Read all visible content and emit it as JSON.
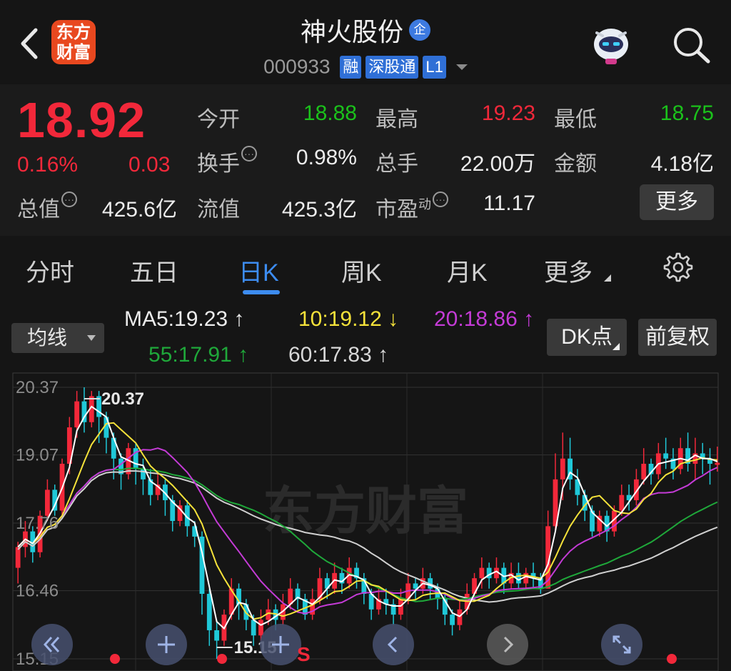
{
  "header": {
    "logo_line1": "东方",
    "logo_line2": "财富",
    "stock_name": "神火股份",
    "badge": "企",
    "code": "000933",
    "tags": [
      "融",
      "深股通",
      "L1"
    ]
  },
  "quote": {
    "price": "18.92",
    "change_pct": "0.16%",
    "change_val": "0.03",
    "fields": {
      "open_label": "今开",
      "open_value": "18.88",
      "high_label": "最高",
      "high_value": "19.23",
      "low_label": "最低",
      "low_value": "18.75",
      "turnover_label": "换手",
      "turnover_value": "0.98%",
      "volume_label": "总手",
      "volume_value": "22.00万",
      "amount_label": "金额",
      "amount_value": "4.18亿",
      "mktcap_label": "总值",
      "mktcap_value": "425.6亿",
      "float_label": "流值",
      "float_value": "425.3亿",
      "pe_label": "市盈",
      "pe_sup": "动",
      "pe_value": "11.17"
    },
    "more_label": "更多"
  },
  "tabs": [
    "分时",
    "五日",
    "日K",
    "周K",
    "月K",
    "更多"
  ],
  "active_tab": "日K",
  "ma": {
    "select_label": "均线",
    "ma5": "MA5:19.23 ↑",
    "ma10": "10:19.12 ↓",
    "ma20": "20:18.86 ↑",
    "ma55": "55:17.91 ↑",
    "ma60": "60:17.83 ↑",
    "dk_label": "DK点",
    "fq_label": "前复权"
  },
  "colors": {
    "up": "#f2283a",
    "down": "#1fc8d8",
    "ma5": "#ffffff",
    "ma10": "#f5e23a",
    "ma20": "#c43bd6",
    "ma55": "#1fa83a",
    "ma60": "#d0d0d0",
    "accent": "#3d8cf0"
  },
  "chart_data": {
    "type": "candlestick",
    "y_ticks": [
      "20.37",
      "19.07",
      "17.76",
      "16.46",
      "15.15"
    ],
    "ylim": [
      15.15,
      20.37
    ],
    "high_marker": "20.37",
    "low_marker": "15.15",
    "watermark": "东方财富",
    "signal_label": "S",
    "candles": [
      [
        16.9,
        17.3,
        16.6,
        17.4
      ],
      [
        17.3,
        17.6,
        17.1,
        17.8
      ],
      [
        17.6,
        17.2,
        17.0,
        17.7
      ],
      [
        17.2,
        17.9,
        17.1,
        18.0
      ],
      [
        17.9,
        18.4,
        17.8,
        18.6
      ],
      [
        18.4,
        18.0,
        17.9,
        18.5
      ],
      [
        18.0,
        18.9,
        17.9,
        19.0
      ],
      [
        18.9,
        19.6,
        18.7,
        19.8
      ],
      [
        19.6,
        20.1,
        19.4,
        20.3
      ],
      [
        20.1,
        19.7,
        19.5,
        20.37
      ],
      [
        19.7,
        20.2,
        19.6,
        20.3
      ],
      [
        20.2,
        19.8,
        19.3,
        20.3
      ],
      [
        19.8,
        19.4,
        19.1,
        19.9
      ],
      [
        19.4,
        19.0,
        18.6,
        19.5
      ],
      [
        19.0,
        18.7,
        18.4,
        19.1
      ],
      [
        18.7,
        19.2,
        18.6,
        19.3
      ],
      [
        19.2,
        18.8,
        18.5,
        19.3
      ],
      [
        18.8,
        18.6,
        18.3,
        19.0
      ],
      [
        18.6,
        18.3,
        18.1,
        18.8
      ],
      [
        18.3,
        18.5,
        18.2,
        18.7
      ],
      [
        18.5,
        18.2,
        17.9,
        18.6
      ],
      [
        18.2,
        17.8,
        17.6,
        18.3
      ],
      [
        17.8,
        18.1,
        17.7,
        18.2
      ],
      [
        18.1,
        17.7,
        17.5,
        18.2
      ],
      [
        17.7,
        17.5,
        17.3,
        17.8
      ],
      [
        17.5,
        16.4,
        16.0,
        17.6
      ],
      [
        16.4,
        15.7,
        15.4,
        16.5
      ],
      [
        15.7,
        15.5,
        15.15,
        15.9
      ],
      [
        15.5,
        16.0,
        15.4,
        16.1
      ],
      [
        16.0,
        16.5,
        15.9,
        16.7
      ],
      [
        16.5,
        16.2,
        15.9,
        16.6
      ],
      [
        16.2,
        15.9,
        15.7,
        16.3
      ],
      [
        15.9,
        15.6,
        15.4,
        16.0
      ],
      [
        15.6,
        15.9,
        15.5,
        16.1
      ],
      [
        15.9,
        16.1,
        15.8,
        16.3
      ],
      [
        16.1,
        15.9,
        15.7,
        16.2
      ],
      [
        15.9,
        16.2,
        15.8,
        16.4
      ],
      [
        16.2,
        16.5,
        16.1,
        16.7
      ],
      [
        16.5,
        16.3,
        16.1,
        16.6
      ],
      [
        16.3,
        16.0,
        15.9,
        16.4
      ],
      [
        16.0,
        16.3,
        15.9,
        16.5
      ],
      [
        16.3,
        16.7,
        16.2,
        16.9
      ],
      [
        16.7,
        16.5,
        16.3,
        16.8
      ],
      [
        16.5,
        16.8,
        16.4,
        17.0
      ],
      [
        16.8,
        16.6,
        16.4,
        16.9
      ],
      [
        16.6,
        16.9,
        16.5,
        17.1
      ],
      [
        16.9,
        16.7,
        16.5,
        17.0
      ],
      [
        16.7,
        16.4,
        16.2,
        16.8
      ],
      [
        16.4,
        16.1,
        15.9,
        16.5
      ],
      [
        16.1,
        16.3,
        16.0,
        16.5
      ],
      [
        16.3,
        16.2,
        16.0,
        16.5
      ],
      [
        16.2,
        16.0,
        15.8,
        16.3
      ],
      [
        16.0,
        16.3,
        15.9,
        16.5
      ],
      [
        16.3,
        16.6,
        16.2,
        16.8
      ],
      [
        16.6,
        16.5,
        16.3,
        16.7
      ],
      [
        16.5,
        16.7,
        16.4,
        16.9
      ],
      [
        16.7,
        16.5,
        16.3,
        16.8
      ],
      [
        16.5,
        16.3,
        16.1,
        16.6
      ],
      [
        16.3,
        16.0,
        15.8,
        16.4
      ],
      [
        16.0,
        15.8,
        15.6,
        16.1
      ],
      [
        15.8,
        16.1,
        15.7,
        16.3
      ],
      [
        16.1,
        16.4,
        16.0,
        16.6
      ],
      [
        16.4,
        16.7,
        16.3,
        16.8
      ],
      [
        16.7,
        16.9,
        16.5,
        17.1
      ],
      [
        16.9,
        16.7,
        16.5,
        17.0
      ],
      [
        16.7,
        16.9,
        16.6,
        17.1
      ],
      [
        16.9,
        16.6,
        16.4,
        17.0
      ],
      [
        16.6,
        16.8,
        16.5,
        17.0
      ],
      [
        16.8,
        16.6,
        16.5,
        17.0
      ],
      [
        16.6,
        16.8,
        16.5,
        16.9
      ],
      [
        16.8,
        16.7,
        16.5,
        17.0
      ],
      [
        16.7,
        16.5,
        16.4,
        16.8
      ],
      [
        16.5,
        17.7,
        16.5,
        18.0
      ],
      [
        17.7,
        18.6,
        17.6,
        19.1
      ],
      [
        18.6,
        19.0,
        18.2,
        19.5
      ],
      [
        19.0,
        18.6,
        18.4,
        19.4
      ],
      [
        18.6,
        18.3,
        18.1,
        18.8
      ],
      [
        18.3,
        18.0,
        17.8,
        18.4
      ],
      [
        18.0,
        17.6,
        17.5,
        18.1
      ],
      [
        17.6,
        17.9,
        17.5,
        18.0
      ],
      [
        17.9,
        17.6,
        17.4,
        18.0
      ],
      [
        17.6,
        18.0,
        17.5,
        18.1
      ],
      [
        18.0,
        18.3,
        17.9,
        18.5
      ],
      [
        18.3,
        18.2,
        18.0,
        18.5
      ],
      [
        18.2,
        18.6,
        18.1,
        18.8
      ],
      [
        18.6,
        18.9,
        18.5,
        19.2
      ],
      [
        18.9,
        18.7,
        18.5,
        19.0
      ],
      [
        18.7,
        19.1,
        18.6,
        19.3
      ],
      [
        19.1,
        19.0,
        18.8,
        19.4
      ],
      [
        19.0,
        18.8,
        18.6,
        19.2
      ],
      [
        18.8,
        19.2,
        18.7,
        19.4
      ],
      [
        19.2,
        18.9,
        18.75,
        19.5
      ],
      [
        18.9,
        19.1,
        18.6,
        19.4
      ],
      [
        19.1,
        19.0,
        18.7,
        19.3
      ],
      [
        19.0,
        18.9,
        18.5,
        19.2
      ],
      [
        18.88,
        18.92,
        18.75,
        19.23
      ]
    ]
  },
  "bottom_controls": [
    "back-icon",
    "plus-icon",
    "plus-icon",
    "chevron-left-icon",
    "chevron-right-icon",
    "expand-icon"
  ]
}
